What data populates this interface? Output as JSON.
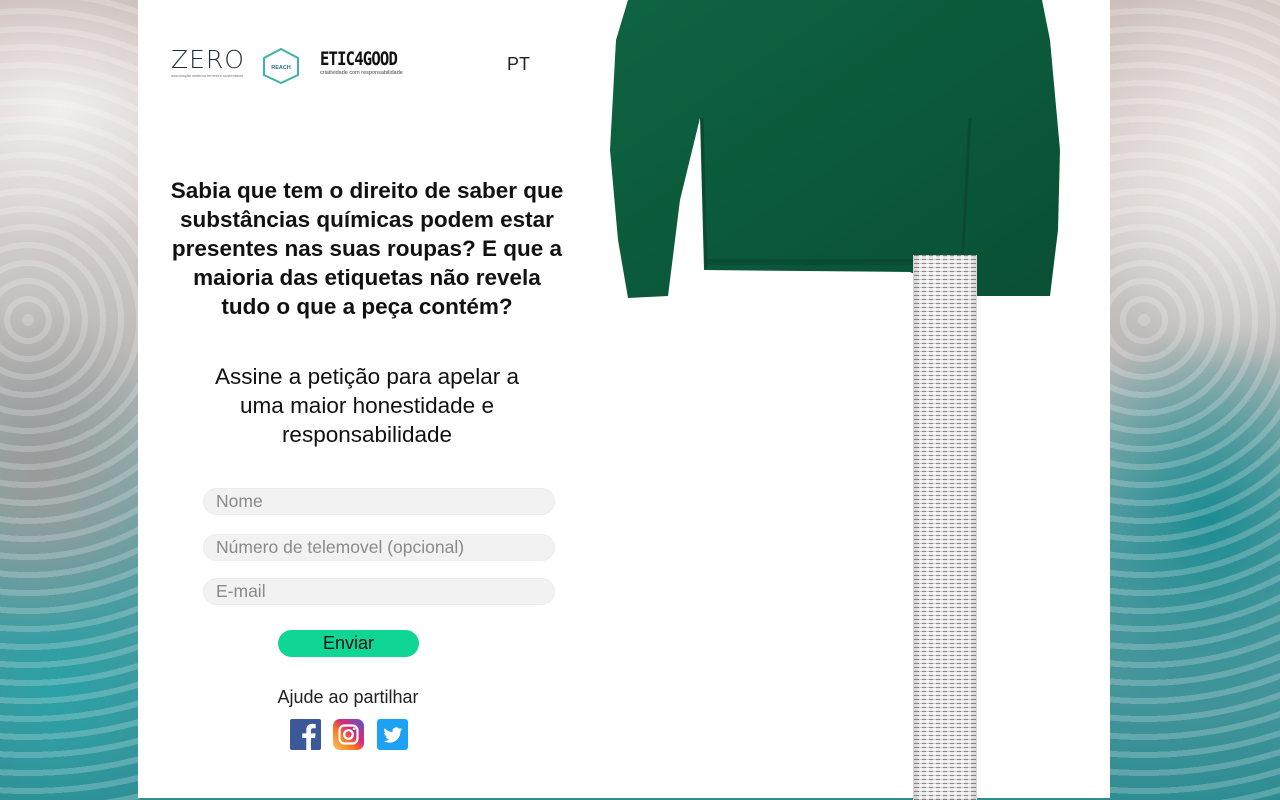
{
  "header": {
    "logo_zero_word": "ZERO",
    "logo_zero_tag": "associação sistema terrestre sustentável",
    "logo_reach_tag": "REACH",
    "logo_etic_word": "ETIC4GOOD",
    "logo_etic_tag": "criatividade com responsabilidade",
    "language": "PT"
  },
  "main": {
    "headline": "Sabia que tem o direito de saber que substâncias químicas podem estar presentes nas suas roupas? E que a maioria das etiquetas não revela tudo o que a peça contém?",
    "subheadline": "Assine a petição para apelar a uma maior honestidade e responsabilidade"
  },
  "form": {
    "name_placeholder": "Nome",
    "phone_placeholder": "Número de telemovel (opcional)",
    "email_placeholder": "E-mail",
    "submit_label": "Enviar",
    "submit_color": "#0fd694"
  },
  "share": {
    "label": "Ajude ao partilhar",
    "icons": [
      "facebook-icon",
      "instagram-icon",
      "twitter-icon"
    ]
  },
  "colors": {
    "panel": "#ffffff",
    "sweater": "#0d5a3b"
  }
}
